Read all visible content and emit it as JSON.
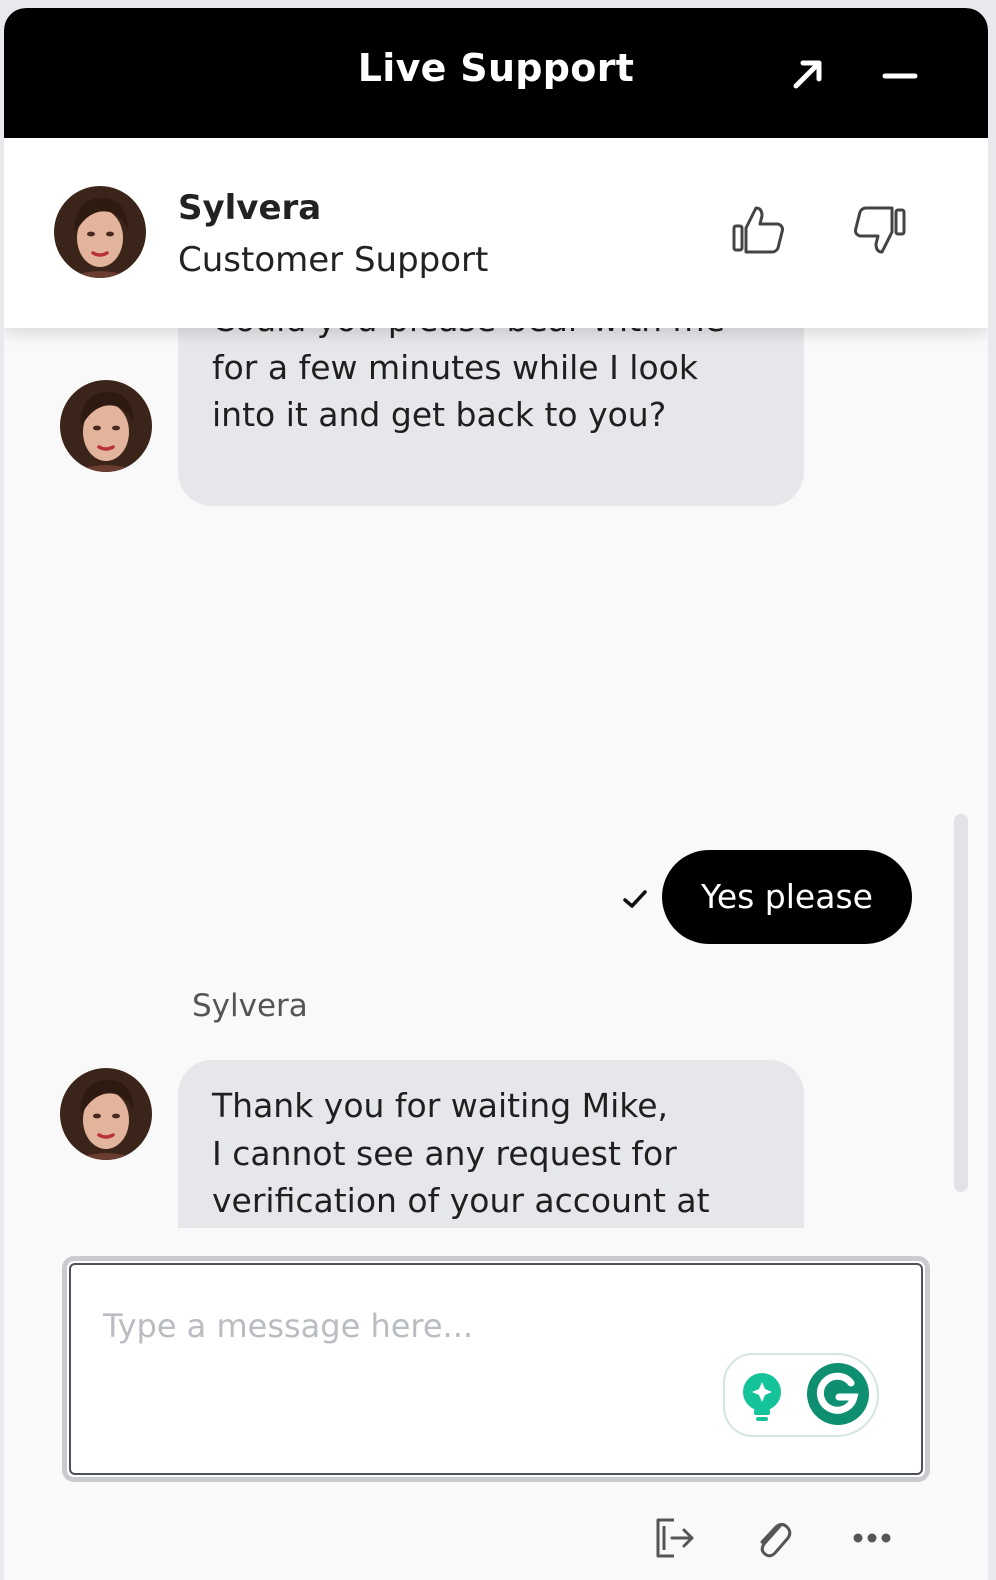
{
  "header": {
    "title": "Live Support"
  },
  "agent": {
    "name": "Sylvera",
    "role": "Customer Support"
  },
  "messages": [
    {
      "from": "agent",
      "text": "Could you please bear with me\nfor a few minutes while I look\ninto it and get back to you?"
    },
    {
      "from": "user",
      "text": "Yes please"
    },
    {
      "from": "agent",
      "sender": "Sylvera",
      "text": "Thank you for waiting Mike,\nI cannot see any request for\nverification of your account at\nthis time, however, if any\ndocuments will be needed in\nthe future, you will be notified\nvia the Verification section in\nyour profile."
    }
  ],
  "composer": {
    "placeholder": "Type a message here..."
  },
  "icons": [
    "expand-icon",
    "minimize-icon",
    "thumbs-up-icon",
    "thumbs-down-icon",
    "check-icon",
    "grammarly-suggestion-icon",
    "grammarly-icon",
    "exit-chat-icon",
    "paperclip-icon",
    "more-icon"
  ],
  "colors": {
    "header": "#000000",
    "agent_bubble": "#e6e7ea",
    "user_bubble": "#000000",
    "grammarly": "#15c39a"
  }
}
